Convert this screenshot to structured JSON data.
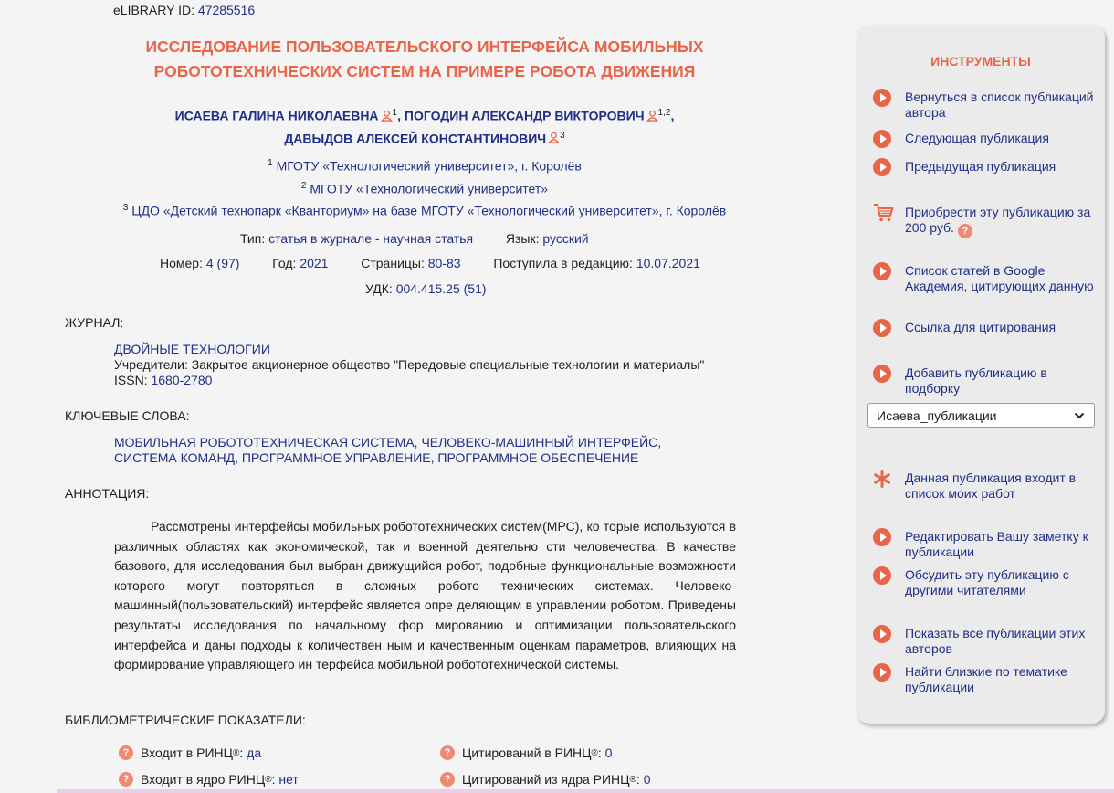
{
  "header": {
    "elibrary_label": "eLIBRARY ID:",
    "elibrary_id": "47285516"
  },
  "article": {
    "title_line1": "ИССЛЕДОВАНИЕ ПОЛЬЗОВАТЕЛЬСКОГО ИНТЕРФЕЙСА МОБИЛЬНЫХ",
    "title_line2": "РОБОТОТЕХНИЧЕСКИХ СИСТЕМ НА ПРИМЕРЕ РОБОТА ДВИЖЕНИЯ",
    "authors": [
      {
        "name": "ИСАЕВА ГАЛИНА НИКОЛАЕВНА",
        "aff": "1"
      },
      {
        "name": "ПОГОДИН АЛЕКСАНДР ВИКТОРОВИЧ",
        "aff": "1,2"
      },
      {
        "name": "ДАВЫДОВ АЛЕКСЕЙ КОНСТАНТИНОВИЧ",
        "aff": "3"
      }
    ],
    "affiliations": [
      {
        "num": "1",
        "text": "МГОТУ «Технологический университет», г. Королёв"
      },
      {
        "num": "2",
        "text": "МГОТУ «Технологический университет»"
      },
      {
        "num": "3",
        "text": "ЦДО «Детский технопарк «Кванториум» на базе МГОТУ «Технологический университет», г. Королёв"
      }
    ],
    "type_label": "Тип:",
    "type_value": "статья в журнале - научная статья",
    "lang_label": "Язык:",
    "lang_value": "русский",
    "number_label": "Номер:",
    "number_value": "4 (97)",
    "year_label": "Год:",
    "year_value": "2021",
    "pages_label": "Страницы:",
    "pages_value": "80-83",
    "received_label": "Поступила в редакцию:",
    "received_value": "10.07.2021",
    "udk_label": "УДК:",
    "udk_value": "004.415.25 (51)"
  },
  "journal": {
    "heading": "ЖУРНАЛ:",
    "name": "ДВОЙНЫЕ ТЕХНОЛОГИИ",
    "founders": "Учредители: Закрытое акционерное общество \"Передовые специальные технологии и материалы\"",
    "issn_label": "ISSN:",
    "issn_value": "1680-2780"
  },
  "keywords": {
    "heading": "КЛЮЧЕВЫЕ СЛОВА:",
    "text": "МОБИЛЬНАЯ РОБОТОТЕХНИЧЕСКАЯ СИСТЕМА, ЧЕЛОВЕКО-МАШИННЫЙ ИНТЕРФЕЙС, СИСТЕМА КОМАНД, ПРОГРАММНОЕ УПРАВЛЕНИЕ, ПРОГРАММНОЕ ОБЕСПЕЧЕНИЕ"
  },
  "abstract": {
    "heading": "АННОТАЦИЯ:",
    "text": "Рассмотрены интерфейсы мобильных робототехнических систем(МРС), ко торые используются в различных областях как экономической, так и военной деятельно сти человечества. В качестве базового, для исследования был выбран движущийся робот, подобные функциональные возможности которого могут повторяться в сложных робото технических системах. Человеко-машинный(пользовательский) интерфейс является опре деляющим в управлении роботом. Приведены результаты исследования по начальному фор мированию и оптимизации пользовательского интерфейса и даны подходы к количествен ным и качественным оценкам параметров, влияющих на формирование управляющего ин терфейса мобильной робототехнической системы."
  },
  "biblio": {
    "heading": "БИБЛИОМЕТРИЧЕСКИЕ ПОКАЗАТЕЛИ:",
    "rinc_label": "Входит в РИНЦ",
    "rinc_value": "да",
    "core_label": "Входит в ядро РИНЦ",
    "core_value": "нет",
    "cit_label": "Цитирований в РИНЦ",
    "cit_value": "0",
    "cit_core_label": "Цитирований из ядра РИНЦ",
    "cit_core_value": "0",
    "reg_mark": "®"
  },
  "sidebar": {
    "title": "ИНСТРУМЕНТЫ",
    "items": {
      "back": "Вернуться в список публикаций автора",
      "next": "Следующая публикация",
      "prev": "Предыдущая публикация",
      "buy": "Приобрести эту публикацию за 200 руб.",
      "scholar": "Список статей в Google Академия, цитирующих данную",
      "cite": "Ссылка для цитирования",
      "collection": "Добавить публикацию в подборку",
      "myworks": "Данная публикация входит в список моих работ",
      "note": "Редактировать Вашу заметку к публикации",
      "discuss": "Обсудить эту публикацию с другими читателями",
      "all_by_authors": "Показать все публикации этих авторов",
      "similar": "Найти близкие по тематике публикации"
    },
    "collection_select": "Исаева_публикации"
  },
  "colors": {
    "accent": "#e8654a",
    "link": "#1f2f86",
    "sidebar_bg": "#ecebec"
  },
  "icons": [
    "person-icon",
    "play-icon",
    "cart-icon",
    "help-icon",
    "asterisk-icon",
    "chevron-down-icon"
  ]
}
